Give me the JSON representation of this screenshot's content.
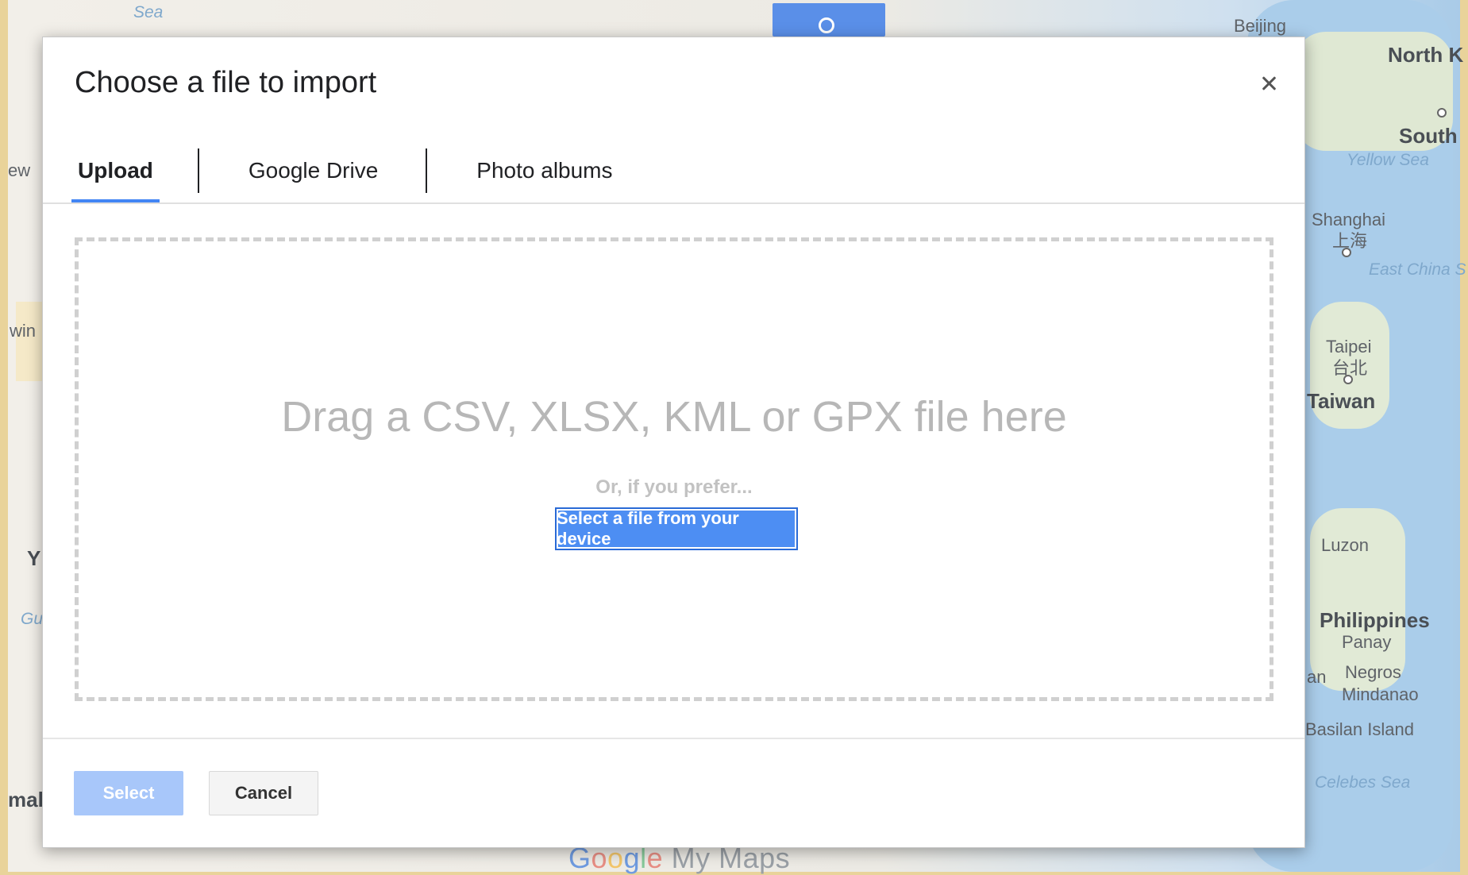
{
  "dialog": {
    "title": "Choose a file to import",
    "close_icon": "close-icon",
    "tabs": [
      {
        "label": "Upload",
        "active": true
      },
      {
        "label": "Google Drive",
        "active": false
      },
      {
        "label": "Photo albums",
        "active": false
      }
    ],
    "dropzone": {
      "headline": "Drag a CSV, XLSX, KML or GPX file here",
      "or_text": "Or, if you prefer...",
      "select_button": "Select a file from your device"
    },
    "footer": {
      "select_label": "Select",
      "cancel_label": "Cancel"
    }
  },
  "map": {
    "labels": {
      "beijing": "Beijing",
      "north_k": "North K",
      "south": "South",
      "yellow_sea": "Yellow Sea",
      "shanghai": "Shanghai",
      "shanghai_cn": "上海",
      "east_china_sea": "East China S",
      "taipei": "Taipei",
      "taipei_cn": "台北",
      "taiwan": "Taiwan",
      "luzon": "Luzon",
      "philippines": "Philippines",
      "panay": "Panay",
      "negros": "Negros",
      "mindanao": "Mindanao",
      "basilan": "Basilan Island",
      "celebes_sea": "Celebes Sea",
      "sea_top": "Sea",
      "ew": "ew",
      "win": "win",
      "y": "Y",
      "gu": "Gu",
      "mal": "mal",
      "an": "an"
    },
    "logo": {
      "g1": "G",
      "g2": "o",
      "g3": "o",
      "g4": "g",
      "g5": "l",
      "g6": "e",
      "rest": " My Maps"
    },
    "colors": {
      "water": "#aacdea",
      "land": "#e6eddc",
      "frame": "#e9d39a"
    }
  }
}
